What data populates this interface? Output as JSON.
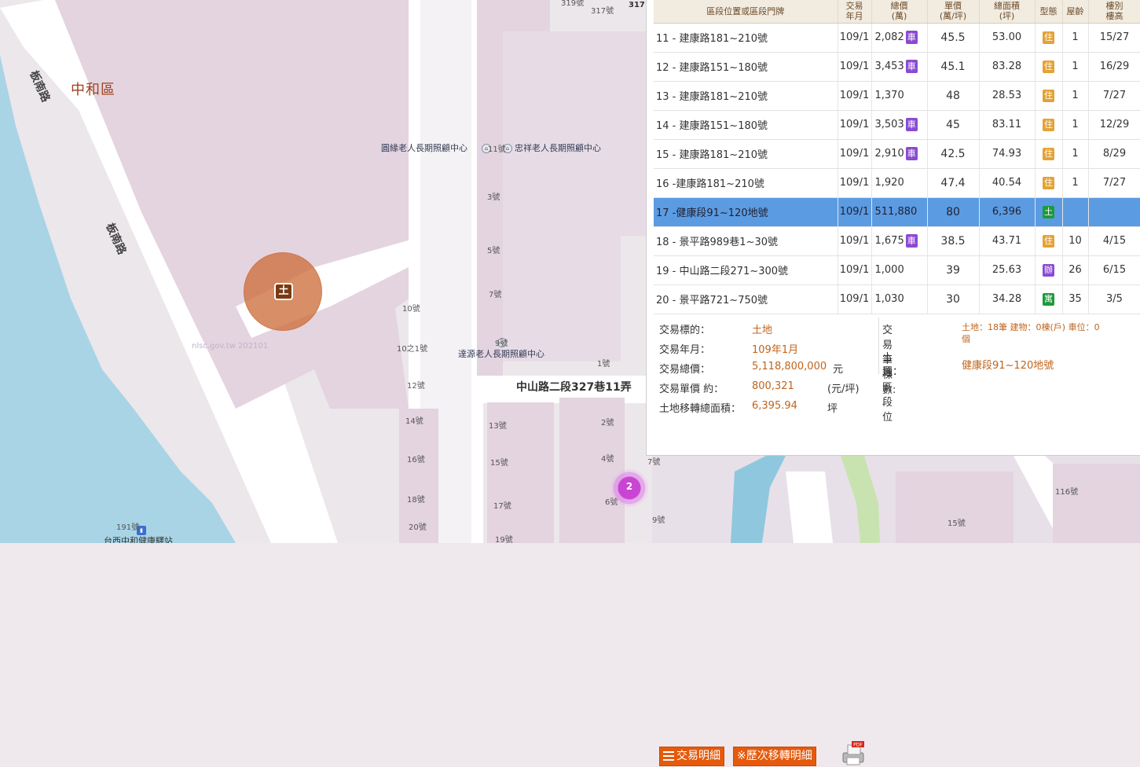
{
  "map": {
    "district": "中和區",
    "roads": {
      "banan_top": "板南路",
      "banan_mid": "板南路",
      "zhongshan_lane": "中山路二段327巷11弄"
    },
    "pois": {
      "care_center_1": "圓緣老人長期照顧中心",
      "care_center_2": "忠祥老人長期照顧中心",
      "care_center_3": "達源老人長期照顧中心",
      "station": "台西中和健康驛站"
    },
    "house_numbers": {
      "n319": "319號",
      "n317": "317號",
      "n317b": "317",
      "n11": "11號",
      "n3": "3號",
      "n5": "5號",
      "n7": "7號",
      "n10": "10號",
      "n10_1": "10之1號",
      "n9": "9號",
      "n1": "1號",
      "n12": "12號",
      "n14": "14號",
      "n16": "16號",
      "n18": "18號",
      "n20": "20號",
      "n13": "13號",
      "n15": "15號",
      "n17": "17號",
      "n19": "19號",
      "n2": "2號",
      "n4": "4號",
      "n6": "6號",
      "n7b": "7號",
      "n9b": "9號",
      "n191": "191號",
      "n116": "116號",
      "n15b": "15號"
    },
    "watermark": "nlsc.gov.tw 202101",
    "marker_label": "土",
    "cluster_count": "2"
  },
  "panel": {
    "headers": {
      "location": "區段位置或區段門牌",
      "date": "交易\n年月",
      "total": "總價\n(萬)",
      "unit": "單價\n(萬/坪)",
      "area": "總面積\n(坪)",
      "type": "型態",
      "age": "屋齡",
      "floor": "樓別\n樓高"
    },
    "rows": [
      {
        "loc": "11 - 建康路181~210號",
        "date": "109/1",
        "total": "2,082",
        "car": "車",
        "unit": "45.5",
        "area": "53.00",
        "type": "住",
        "type_kind": "res",
        "age": "1",
        "floor": "15/27"
      },
      {
        "loc": "12 - 建康路151~180號",
        "date": "109/1",
        "total": "3,453",
        "car": "車",
        "unit": "45.1",
        "area": "83.28",
        "type": "住",
        "type_kind": "res",
        "age": "1",
        "floor": "16/29"
      },
      {
        "loc": "13 - 建康路181~210號",
        "date": "109/1",
        "total": "1,370",
        "car": "",
        "unit": "48",
        "area": "28.53",
        "type": "住",
        "type_kind": "res",
        "age": "1",
        "floor": "7/27"
      },
      {
        "loc": "14 - 建康路151~180號",
        "date": "109/1",
        "total": "3,503",
        "car": "車",
        "unit": "45",
        "area": "83.11",
        "type": "住",
        "type_kind": "res",
        "age": "1",
        "floor": "12/29"
      },
      {
        "loc": "15 - 建康路181~210號",
        "date": "109/1",
        "total": "2,910",
        "car": "車",
        "unit": "42.5",
        "area": "74.93",
        "type": "住",
        "type_kind": "res",
        "age": "1",
        "floor": "8/29"
      },
      {
        "loc": "16 -建康路181~210號",
        "date": "109/1",
        "total": "1,920",
        "car": "",
        "unit": "47.4",
        "area": "40.54",
        "type": "住",
        "type_kind": "res",
        "age": "1",
        "floor": "7/27"
      },
      {
        "loc": "17 -健康段91~120地號",
        "date": "109/1",
        "total": "511,880",
        "car": "",
        "unit": "80",
        "area": "6,396",
        "type": "土",
        "type_kind": "land",
        "age": "",
        "floor": "",
        "selected": true
      },
      {
        "loc": "18 - 景平路989巷1~30號",
        "date": "109/1",
        "total": "1,675",
        "car": "車",
        "unit": "38.5",
        "area": "43.71",
        "type": "住",
        "type_kind": "res",
        "age": "10",
        "floor": "4/15"
      },
      {
        "loc": "19 - 中山路二段271~300號",
        "date": "109/1",
        "total": "1,000",
        "car": "",
        "unit": "39",
        "area": "25.63",
        "type": "辦",
        "type_kind": "office",
        "age": "26",
        "floor": "6/15"
      },
      {
        "loc": "20 - 景平路721~750號",
        "date": "109/1",
        "total": "1,030",
        "car": "",
        "unit": "30",
        "area": "34.28",
        "type": "寓",
        "type_kind": "apt",
        "age": "35",
        "floor": "3/5"
      }
    ],
    "detail": {
      "target_key": "交易標的：",
      "target_val": "土地",
      "date_key": "交易年月：",
      "date_val": "109年1月",
      "total_key": "交易總價：",
      "total_val": "5,118,800,000",
      "total_unit": "元",
      "unit_key": "交易單價 約：",
      "unit_val": "800,321",
      "unit_unit": "(元/坪)",
      "area_key": "土地移轉總面積：",
      "area_val": "6,395.94",
      "area_unit": "坪",
      "count_key": "交易筆棟數:",
      "count_val_1": "土地：18筆 建物：0棟(戶) 車位：0",
      "count_val_2": "個",
      "loc_key_1": "土地區段位",
      "loc_key_2": "置：",
      "loc_val": "健康段91~120地號"
    },
    "buttons": {
      "detail": "交易明細",
      "history": "※歷次移轉明細"
    },
    "colors": {
      "accent": "#e55a0c",
      "selected_row": "#5b9be2",
      "value_text": "#c0641c",
      "header_bg": "#f1ebe0"
    },
    "icons": {
      "menu": "menu-icon",
      "print_pdf": "pdf-print-icon"
    }
  }
}
